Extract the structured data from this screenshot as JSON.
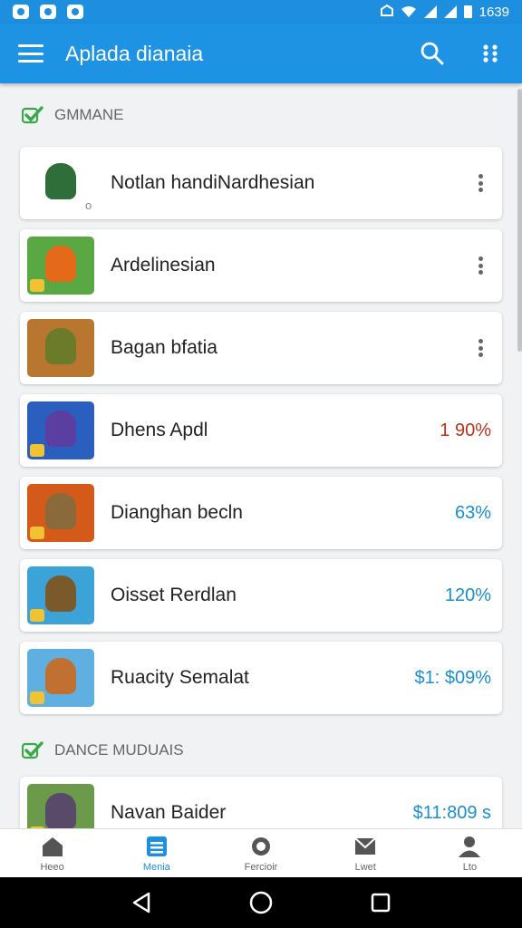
{
  "status_bar": {
    "time": "1639"
  },
  "app_bar": {
    "title": "Aplada dianaia"
  },
  "sections": [
    {
      "title": "GMMANE",
      "items": [
        {
          "title": "Notlan handiNardhesian",
          "value": "",
          "accent": "#2f6e3a",
          "bg": "#ffffff"
        },
        {
          "title": "Ardelinesian",
          "value": "",
          "accent": "#e46a1a",
          "bg": "#5aa844"
        },
        {
          "title": "Bagan bfatia",
          "value": "",
          "accent": "#6b7b2a",
          "bg": "#b8762f"
        },
        {
          "title": "Dhens Apdl",
          "value": "1 90%",
          "value_color": "#b8331e",
          "accent": "#5a3ea0",
          "bg": "#2b5fbf"
        },
        {
          "title": "Dianghan becln",
          "value": "63%",
          "value_color": "#1a8fd0",
          "accent": "#8a6a3a",
          "bg": "#d45a1a"
        },
        {
          "title": "Oisset Rerdlan",
          "value": "120%",
          "value_color": "#1a8fd0",
          "accent": "#7a5a2a",
          "bg": "#3ba3d8"
        },
        {
          "title": "Ruacity Semalat",
          "value": "$1: $09%",
          "value_color": "#1a8fd0",
          "accent": "#c07030",
          "bg": "#5fb0e0"
        }
      ]
    },
    {
      "title": "DANCE MUDUAIS",
      "items": [
        {
          "title": "Navan Baider",
          "value": "$11:809 s",
          "value_color": "#1a8fd0",
          "accent": "#5a4a6a",
          "bg": "#6b9b4a"
        }
      ]
    }
  ],
  "bottom_nav": [
    {
      "label": "Heeo",
      "icon": "home-icon"
    },
    {
      "label": "Menia",
      "icon": "list-icon"
    },
    {
      "label": "Fercioir",
      "icon": "settings-icon"
    },
    {
      "label": "Lwet",
      "icon": "mail-icon"
    },
    {
      "label": "Lto",
      "icon": "person-icon"
    }
  ],
  "colors": {
    "primary": "#1f93e3",
    "check": "#3aa84a"
  }
}
